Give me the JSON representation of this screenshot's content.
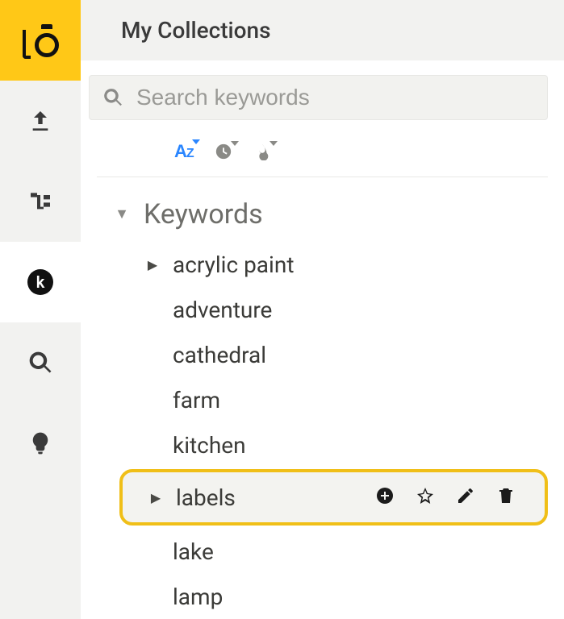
{
  "header": {
    "title": "My Collections"
  },
  "search": {
    "placeholder": "Search keywords"
  },
  "sort": {
    "modes": [
      "az",
      "recent",
      "popular"
    ],
    "active": "az"
  },
  "tree": {
    "root_label": "Keywords",
    "expanded": true,
    "items": [
      {
        "label": "acrylic paint",
        "has_children": true,
        "selected": false
      },
      {
        "label": "adventure",
        "has_children": false,
        "selected": false
      },
      {
        "label": "cathedral",
        "has_children": false,
        "selected": false
      },
      {
        "label": "farm",
        "has_children": false,
        "selected": false
      },
      {
        "label": "kitchen",
        "has_children": false,
        "selected": false
      },
      {
        "label": "labels",
        "has_children": true,
        "selected": true
      },
      {
        "label": "lake",
        "has_children": false,
        "selected": false
      },
      {
        "label": "lamp",
        "has_children": false,
        "selected": false
      }
    ]
  },
  "item_actions": {
    "add": "Add child",
    "favorite": "Favorite",
    "edit": "Edit",
    "delete": "Delete"
  },
  "rail": {
    "items": [
      {
        "name": "upload",
        "active": false
      },
      {
        "name": "organize",
        "active": false
      },
      {
        "name": "keywords",
        "active": true
      },
      {
        "name": "search",
        "active": false
      },
      {
        "name": "ideas",
        "active": false
      }
    ]
  }
}
